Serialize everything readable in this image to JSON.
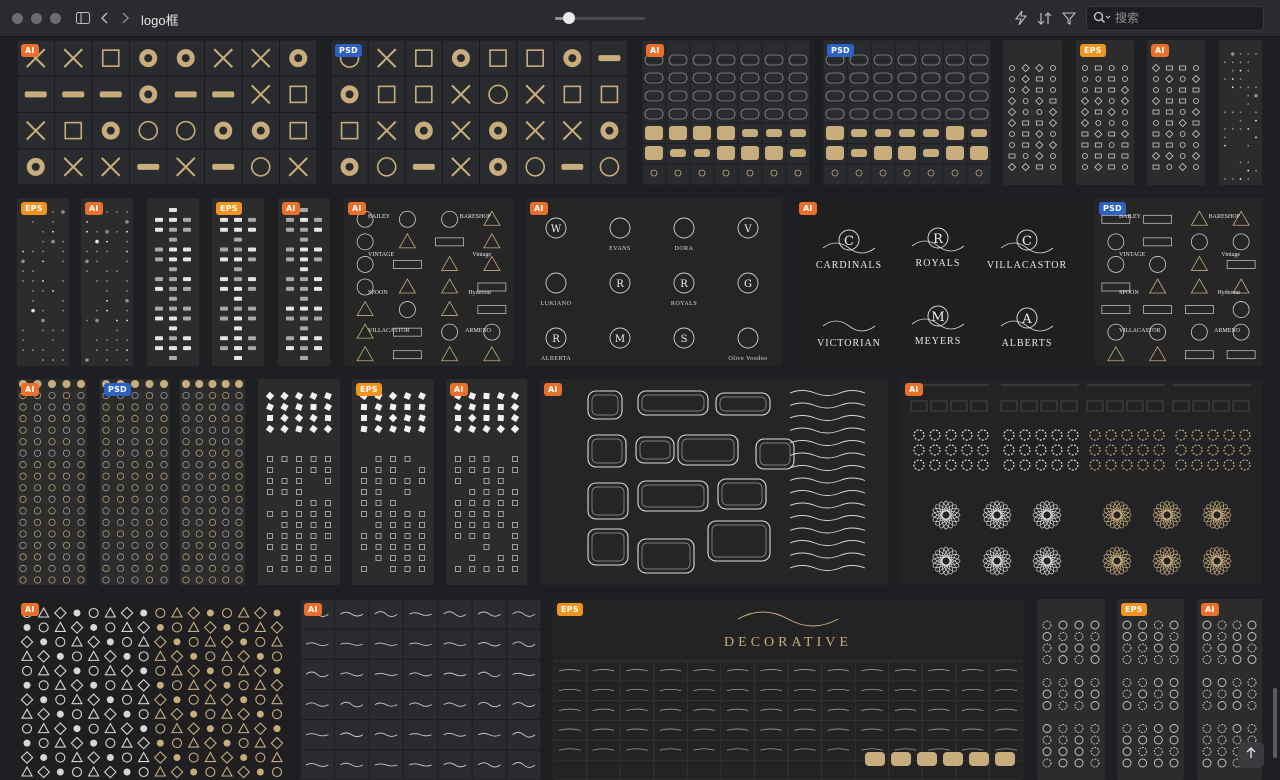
{
  "window": {
    "title": "logo框",
    "search_placeholder": "搜索",
    "zoom_level": 0.15
  },
  "icons": {
    "sidebar_toggle": "sidebar-icon",
    "back": "chevron-left-icon",
    "forward": "chevron-right-icon",
    "quick_action": "lightning-icon",
    "sort": "sort-icon",
    "filter": "filter-icon",
    "search": "search-icon",
    "scroll_top": "arrow-up-icon"
  },
  "colors": {
    "ai_badge": "#e8702a",
    "eps_badge": "#f0941f",
    "psd_badge": "#2d62c4",
    "gold": "#c7ad7c",
    "tile_dark": "#2c2c2d",
    "tile_grid": "#2a2b2e"
  },
  "tiles": [
    {
      "badge": "AI",
      "art": "icons-gold",
      "label": ""
    },
    {
      "badge": "PSD",
      "art": "icons-gold",
      "label": ""
    },
    {
      "badge": "AI",
      "art": "frames",
      "label": ""
    },
    {
      "badge": "PSD",
      "art": "frames",
      "label": ""
    },
    {
      "badge": "",
      "art": "ornament-column",
      "label": ""
    },
    {
      "badge": "EPS",
      "art": "ornament-column",
      "label": ""
    },
    {
      "badge": "AI",
      "art": "ornament-column",
      "label": ""
    },
    {
      "badge": "",
      "art": "sparse-column",
      "label": ""
    },
    {
      "badge": "EPS",
      "art": "sparse-column",
      "label": ""
    },
    {
      "badge": "AI",
      "art": "sparse-column",
      "label": ""
    },
    {
      "badge": "",
      "art": "white-column",
      "label": ""
    },
    {
      "badge": "EPS",
      "art": "white-column",
      "label": ""
    },
    {
      "badge": "AI",
      "art": "white-column",
      "label": ""
    },
    {
      "badge": "AI",
      "art": "badges",
      "label": ""
    },
    {
      "badge": "AI",
      "art": "monograms",
      "label": ""
    },
    {
      "badge": "AI",
      "art": "royal-logos",
      "label": ""
    },
    {
      "badge": "PSD",
      "art": "badges",
      "label": ""
    },
    {
      "badge": "AI",
      "art": "circles-gold",
      "label": ""
    },
    {
      "badge": "PSD",
      "art": "circles-gold",
      "label": ""
    },
    {
      "badge": "",
      "art": "circles-gold",
      "label": ""
    },
    {
      "badge": "",
      "art": "white-shapes",
      "label": ""
    },
    {
      "badge": "EPS",
      "art": "white-shapes",
      "label": ""
    },
    {
      "badge": "AI",
      "art": "white-shapes",
      "label": ""
    },
    {
      "badge": "AI",
      "art": "swirl-frames",
      "label": ""
    },
    {
      "badge": "AI",
      "art": "mandalas",
      "label": ""
    },
    {
      "badge": "AI",
      "art": "geo-grid",
      "label": ""
    },
    {
      "badge": "AI",
      "art": "squiggles",
      "label": ""
    },
    {
      "badge": "EPS",
      "art": "decorative",
      "label": "DECORATIVE"
    },
    {
      "badge": "",
      "art": "rings-column",
      "label": ""
    },
    {
      "badge": "EPS",
      "art": "rings-column",
      "label": ""
    },
    {
      "badge": "AI",
      "art": "rings-column",
      "label": ""
    }
  ],
  "royal_logos": [
    {
      "letter": "C",
      "name": "CARDINALS"
    },
    {
      "letter": "R",
      "name": "ROYALS"
    },
    {
      "letter": "C",
      "name": "VILLACASTOR"
    },
    {
      "letter": "",
      "name": "VICTORIAN"
    },
    {
      "letter": "M",
      "name": "MEYERS"
    },
    {
      "letter": "A",
      "name": "ALBERTS"
    }
  ],
  "monograms": [
    {
      "letter": "W",
      "name": ""
    },
    {
      "letter": "",
      "name": "EVANS"
    },
    {
      "letter": "",
      "name": "DORA"
    },
    {
      "letter": "V",
      "name": ""
    },
    {
      "letter": "",
      "name": "LUKIANO"
    },
    {
      "letter": "R",
      "name": ""
    },
    {
      "letter": "R",
      "name": "ROYALS"
    },
    {
      "letter": "G",
      "name": ""
    },
    {
      "letter": "R",
      "name": "ALBERTA"
    },
    {
      "letter": "M",
      "name": ""
    },
    {
      "letter": "S",
      "name": ""
    },
    {
      "letter": "",
      "name": "Olive Voodoo"
    }
  ],
  "badge_words": [
    "BAILEY",
    "BARESHOP",
    "VINTAGE",
    "Vintage",
    "SPOON",
    "Hyderout",
    "VILLACASTOR",
    "ARMENO"
  ]
}
